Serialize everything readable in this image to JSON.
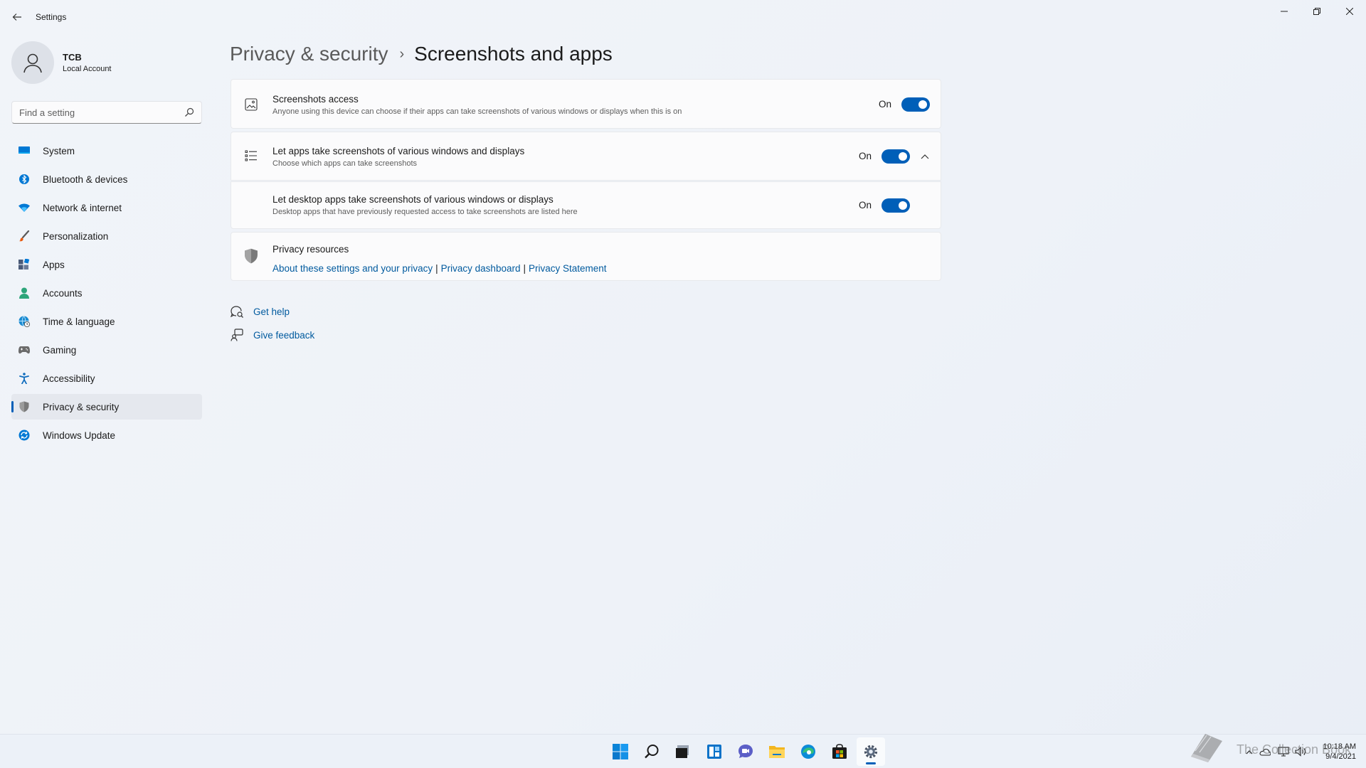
{
  "window": {
    "title": "Settings"
  },
  "profile": {
    "name": "TCB",
    "account_type": "Local Account"
  },
  "search": {
    "placeholder": "Find a setting"
  },
  "sidebar": {
    "items": [
      {
        "label": "System",
        "icon": "system-icon",
        "color": "#0078d4"
      },
      {
        "label": "Bluetooth & devices",
        "icon": "bluetooth-icon",
        "color": "#0078d4"
      },
      {
        "label": "Network & internet",
        "icon": "wifi-icon",
        "color": "#0078d4"
      },
      {
        "label": "Personalization",
        "icon": "brush-icon",
        "color": "#e8590c"
      },
      {
        "label": "Apps",
        "icon": "apps-icon",
        "color": "#4a5a78"
      },
      {
        "label": "Accounts",
        "icon": "accounts-icon",
        "color": "#2da57a"
      },
      {
        "label": "Time & language",
        "icon": "globe-clock-icon",
        "color": "#1a8bd1"
      },
      {
        "label": "Gaming",
        "icon": "gamepad-icon",
        "color": "#6b6b6b"
      },
      {
        "label": "Accessibility",
        "icon": "accessibility-icon",
        "color": "#0f6cbd"
      },
      {
        "label": "Privacy & security",
        "icon": "shield-icon",
        "color": "#6b6b6b",
        "active": true
      },
      {
        "label": "Windows Update",
        "icon": "update-icon",
        "color": "#0078d4"
      }
    ]
  },
  "breadcrumb": {
    "parent": "Privacy & security",
    "separator": "›",
    "current": "Screenshots and apps"
  },
  "settings": {
    "screenshots_access": {
      "title": "Screenshots access",
      "description": "Anyone using this device can choose if their apps can take screenshots of various windows or displays when this is on",
      "state": "On"
    },
    "apps_screenshots": {
      "title": "Let apps take screenshots of various windows and displays",
      "description": "Choose which apps can take screenshots",
      "state": "On"
    },
    "desktop_apps_screenshots": {
      "title": "Let desktop apps take screenshots of various windows or displays",
      "description": "Desktop apps that have previously requested access to take screenshots are listed here",
      "state": "On"
    }
  },
  "privacy_resources": {
    "title": "Privacy resources",
    "links": [
      "About these settings and your privacy",
      "Privacy dashboard",
      "Privacy Statement"
    ],
    "separator": "|"
  },
  "help": {
    "get_help": "Get help",
    "give_feedback": "Give feedback"
  },
  "taskbar": {
    "apps": [
      "start-icon",
      "search-icon",
      "task-view-icon",
      "widgets-icon",
      "chat-icon",
      "file-explorer-icon",
      "edge-icon",
      "store-icon",
      "settings-icon"
    ],
    "active_app": "settings-icon",
    "clock_time": "10:18 AM",
    "clock_date": "9/4/2021"
  },
  "watermark": {
    "text": "The Collection Book"
  },
  "colors": {
    "accent": "#005fb8",
    "link": "#005a9e",
    "background": "#f1f4f9"
  }
}
